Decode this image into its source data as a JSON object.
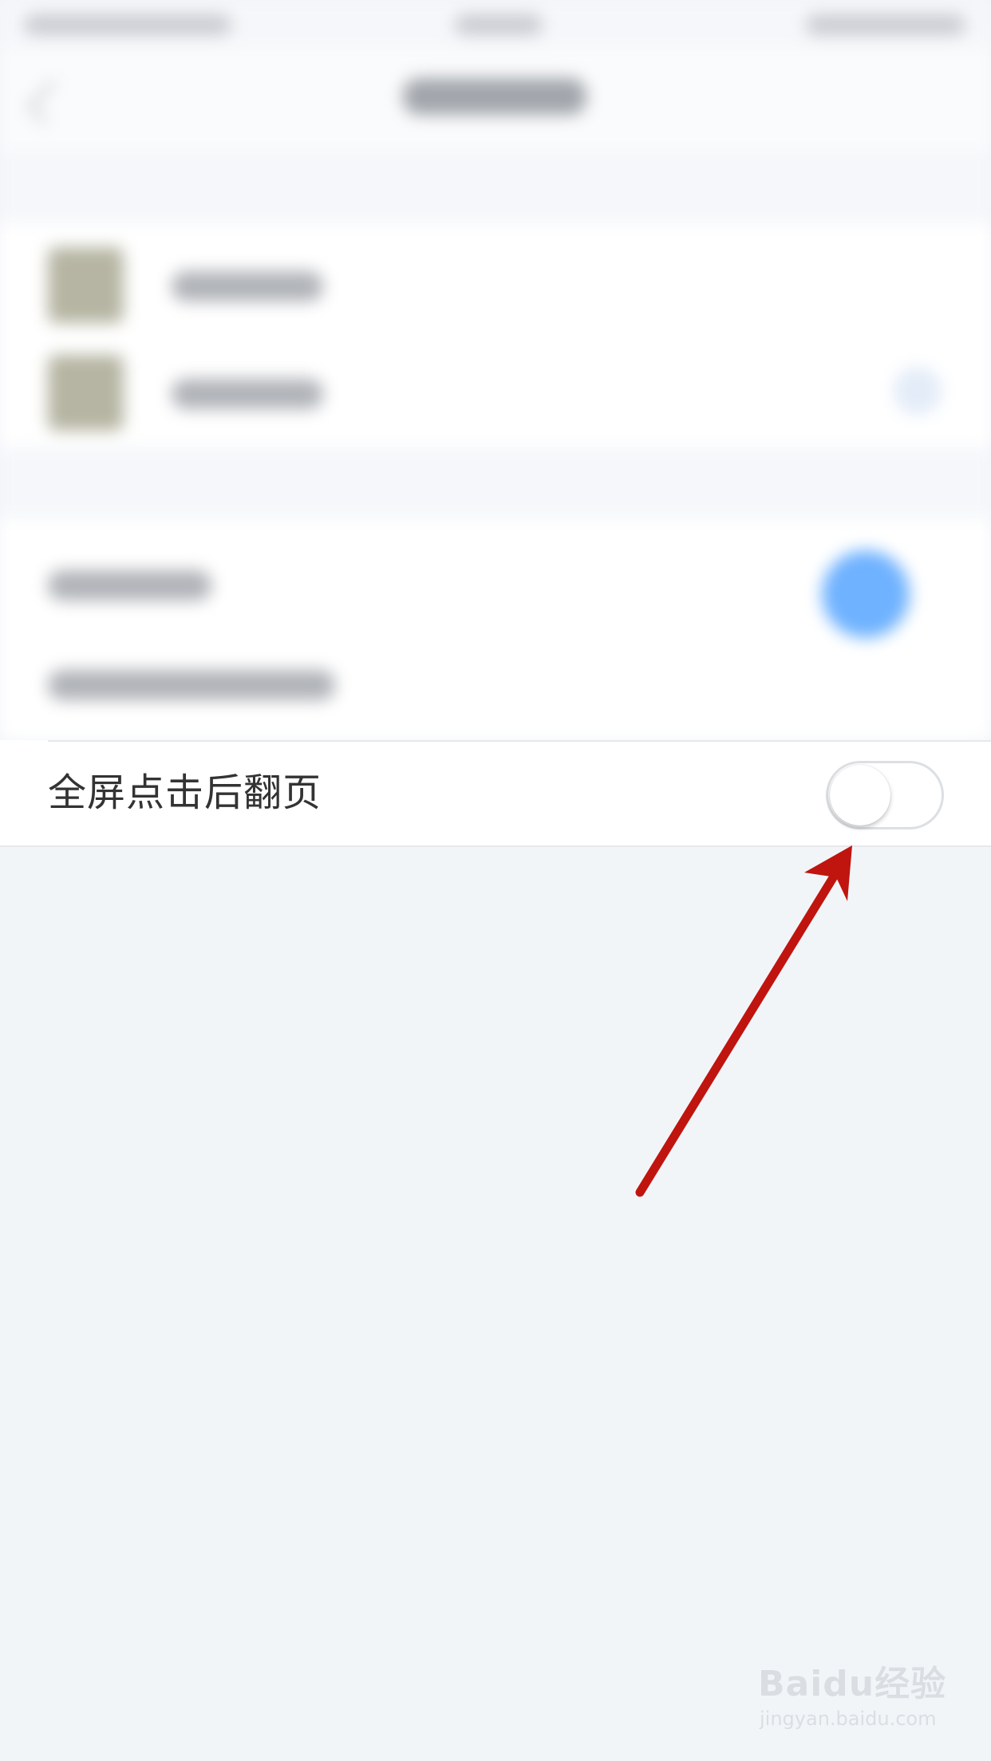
{
  "settings": {
    "fullscreen_tap_label": "全屏点击后翻页",
    "fullscreen_tap_enabled": false
  },
  "annotation": {
    "arrow_color": "#c0140f"
  },
  "watermark": {
    "brand": "Baidu经验",
    "url": "jingyan.baidu.com"
  },
  "colors": {
    "background": "#f2f5f8",
    "card": "#ffffff",
    "accent_blue": "#6fb2ff",
    "text_primary": "#333333"
  }
}
